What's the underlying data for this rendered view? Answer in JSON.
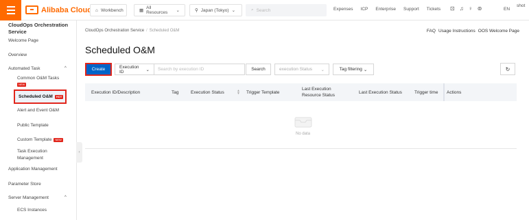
{
  "topbar": {
    "logo_text": "Alibaba Cloud",
    "workbench": "Workbench",
    "resources": "All Resources",
    "region": "Japan (Tokyo)",
    "search_placeholder": "Search",
    "links": [
      "Expenses",
      "ICP",
      "Enterprise",
      "Support",
      "Tickets"
    ],
    "language": "EN",
    "user": "shot",
    "accent_color": "#ff6a00"
  },
  "sidebar": {
    "title": "CloudOps Orchestration Service",
    "welcome": "Welcome Page",
    "overview": "Overview",
    "automated_task": "Automated Task",
    "common_tasks": "Common O&M Tasks",
    "common_tasks_badge": "NEW",
    "scheduled": "Scheduled O&M",
    "scheduled_badge": "HOT",
    "alert": "Alert and Event O&M",
    "public_template": "Public Template",
    "custom_template": "Custom Template",
    "custom_template_badge": "NEW",
    "task_execution": "Task Execution Management",
    "app_management": "Application Management",
    "parameter_store": "Parameter Store",
    "server_management": "Server Management",
    "ecs_instances": "ECS Instances"
  },
  "main": {
    "breadcrumb_root": "CloudOps Orchestration Service",
    "breadcrumb_sep": "/",
    "breadcrumb_current": "Scheduled O&M",
    "header_links": [
      "FAQ",
      "Usage Instructions",
      "OOS Welcome Page"
    ],
    "title": "Scheduled O&M",
    "create": "Create",
    "filter_type": "Execution ID",
    "filter_placeholder": "Search by execution ID",
    "search": "Search",
    "status_placeholder": "execution Status",
    "tag_filter": "Tag filtering",
    "columns": {
      "id": "Execution ID/Description",
      "tag": "Tag",
      "status": "Execution Status",
      "trigger_template": "Trigger Template",
      "last_resource_status": "Last Execution Resource Status",
      "last_status": "Last Execution Status",
      "trigger_time": "Trigger time",
      "actions": "Actions"
    },
    "empty_text": "No data"
  }
}
